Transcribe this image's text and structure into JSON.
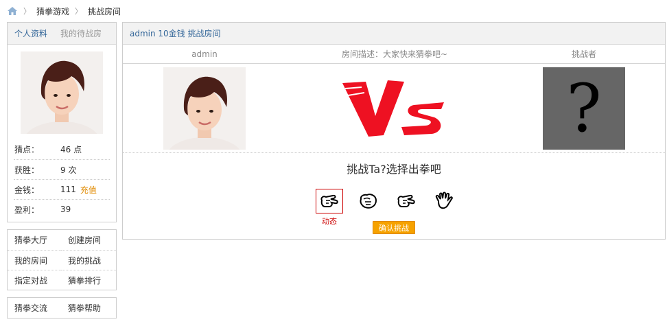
{
  "breadcrumb": {
    "items": [
      "猜拳游戏",
      "挑战房间"
    ]
  },
  "profile": {
    "tabs": [
      "个人资料",
      "我的待战房"
    ],
    "stats": [
      {
        "key": "猜点：",
        "value": "46 点"
      },
      {
        "key": "获胜：",
        "value": "9 次"
      },
      {
        "key": "金钱：",
        "value": "111",
        "action": "充值"
      },
      {
        "key": "盈利：",
        "value": "39"
      }
    ]
  },
  "nav": {
    "items": [
      "猜拳大厅",
      "创建房间",
      "我的房间",
      "我的挑战",
      "指定对战",
      "猜拳排行"
    ]
  },
  "nav2": {
    "items": [
      "猜拳交流",
      "猜拳帮助"
    ]
  },
  "room": {
    "title": "admin 10金钱 挑战房间",
    "host_label": "admin",
    "description": "房间描述：大家快来猜拳吧~",
    "challenger_label": "挑战者",
    "question_mark": "?",
    "prompt": "挑战Ta?选择出拳吧",
    "selected_label": "动态",
    "confirm_label": "确认挑战"
  },
  "choices": [
    {
      "icon": "scissors-hand-icon",
      "selected": true
    },
    {
      "icon": "rock-fist-icon",
      "selected": false
    },
    {
      "icon": "scissors-hand-icon",
      "selected": false
    },
    {
      "icon": "paper-hand-icon",
      "selected": false
    }
  ],
  "colors": {
    "link": "#336699",
    "accent": "#f6a200",
    "vs_red": "#ee1122",
    "selected_border": "#cc0000"
  }
}
